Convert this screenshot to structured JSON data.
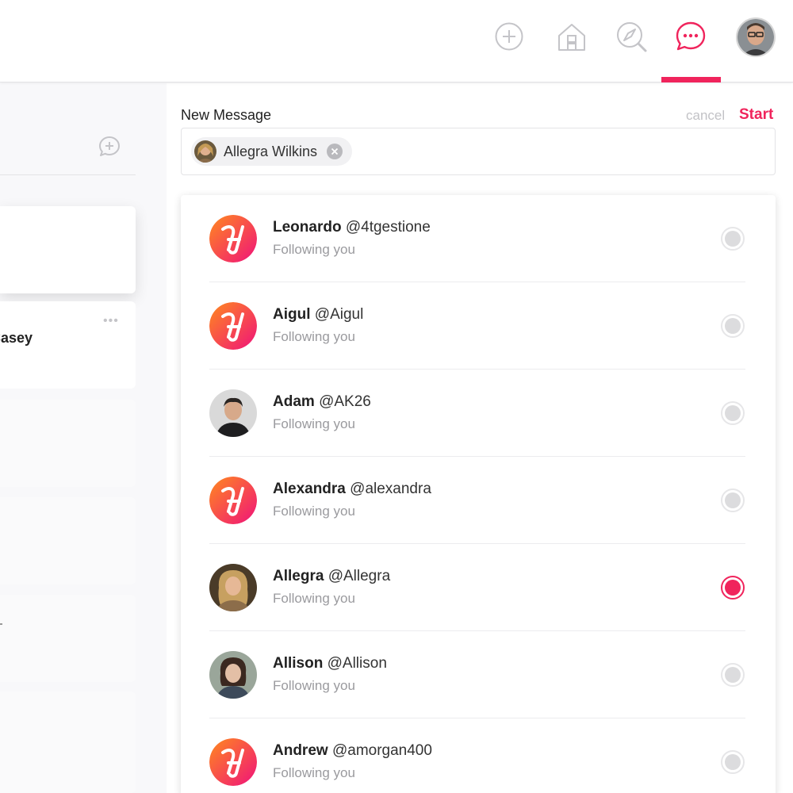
{
  "new_message": {
    "title": "New Message",
    "cancel_label": "cancel",
    "start_label": "Start"
  },
  "recipient_chip": {
    "label": "Allegra Wilkins"
  },
  "conversation_list": {
    "partial_name": "Casey",
    "menu_glyph": "•••"
  },
  "contacts": [
    {
      "name": "Leonardo",
      "handle": "@4tgestione",
      "status": "Following you",
      "avatar": "brand-logo",
      "selected": false
    },
    {
      "name": "Aigul",
      "handle": "@Aigul",
      "status": "Following you",
      "avatar": "brand-logo",
      "selected": false
    },
    {
      "name": "Adam",
      "handle": "@AK26",
      "status": "Following you",
      "avatar": "photo-man",
      "selected": false
    },
    {
      "name": "Alexandra",
      "handle": "@alexandra",
      "status": "Following you",
      "avatar": "brand-logo",
      "selected": false
    },
    {
      "name": "Allegra",
      "handle": "@Allegra",
      "status": "Following you",
      "avatar": "photo-woman-blonde",
      "selected": true
    },
    {
      "name": "Allison",
      "handle": "@Allison",
      "status": "Following you",
      "avatar": "photo-woman-dark",
      "selected": false
    },
    {
      "name": "Andrew",
      "handle": "@amorgan400",
      "status": "Following you",
      "avatar": "brand-logo",
      "selected": false
    }
  ],
  "colors": {
    "accent": "#f0245c",
    "gradient_start": "#ff8a1e",
    "gradient_end": "#f0127a",
    "muted_text": "#9a9a9e"
  }
}
